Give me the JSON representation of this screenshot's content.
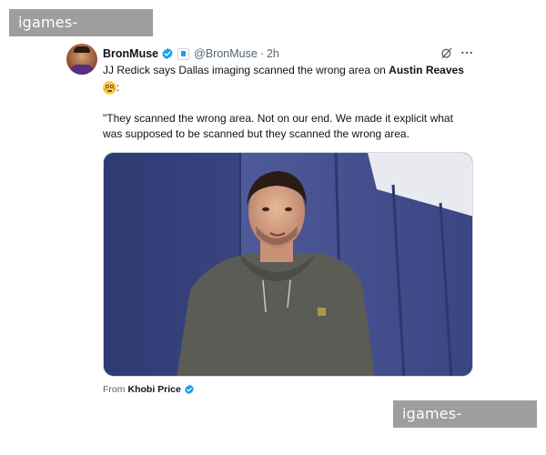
{
  "watermark": {
    "text": "igames-index.com"
  },
  "tweet": {
    "author_name": "BronMuse",
    "handle": "@BronMuse",
    "separator": "·",
    "time": "2h",
    "text_line1_prefix": "JJ Redick says Dallas imaging scanned the wrong area on ",
    "text_line1_bold": "Austin Reaves",
    "text_line2_suffix": ":",
    "quote_lines": [
      "\"They scanned the wrong area. Not on our end. We made it explicit what",
      "was supposed to be scanned but they scanned the wrong area."
    ],
    "media_credit_prefix": "From",
    "media_credit_name": "Khobi Price"
  },
  "icons": {
    "verified": "verified-badge-icon",
    "affiliate": "affiliate-badge-icon",
    "grok": "grok-icon",
    "more": "more-icon",
    "emoji": "flushed-face-emoji"
  },
  "colors": {
    "verified_blue": "#1d9bf0",
    "text_primary": "#0f1419",
    "text_secondary": "#536471",
    "watermark_bg": "#9e9e9e",
    "media_wall": "#3f4a86"
  }
}
